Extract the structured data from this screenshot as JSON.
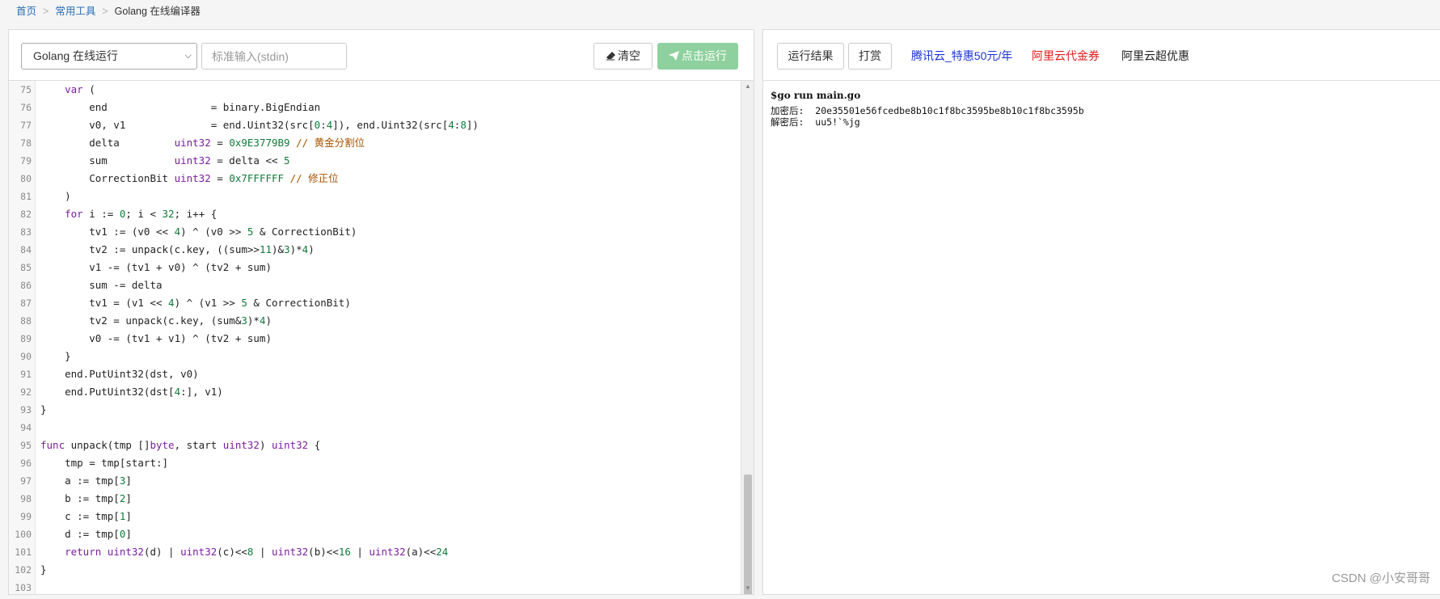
{
  "breadcrumb": {
    "items": [
      "首页",
      "常用工具"
    ],
    "separator": ">",
    "current": "Golang 在线编译器"
  },
  "toolbar": {
    "language_select": "Golang 在线运行",
    "stdin_placeholder": "标准输入(stdin)",
    "clear_label": "清空",
    "run_label": "点击运行"
  },
  "editor": {
    "lines": [
      {
        "n": "75",
        "t": [
          [
            "    "
          ],
          [
            "var",
            "kw"
          ],
          [
            " ("
          ]
        ]
      },
      {
        "n": "76",
        "t": [
          [
            "        end                 = binary.BigEndian"
          ]
        ]
      },
      {
        "n": "77",
        "t": [
          [
            "        v0, v1              = end.Uint32(src["
          ],
          [
            "0",
            "num"
          ],
          [
            ":"
          ],
          [
            "4",
            "num"
          ],
          [
            "]), end.Uint32(src["
          ],
          [
            "4",
            "num"
          ],
          [
            ":"
          ],
          [
            "8",
            "num"
          ],
          [
            "])"
          ]
        ]
      },
      {
        "n": "78",
        "t": [
          [
            "        delta         "
          ],
          [
            "uint32",
            "kw"
          ],
          [
            " = "
          ],
          [
            "0x9E3779B9",
            "num"
          ],
          [
            " "
          ],
          [
            "// 黄金分割位",
            "cm"
          ]
        ]
      },
      {
        "n": "79",
        "t": [
          [
            "        sum           "
          ],
          [
            "uint32",
            "kw"
          ],
          [
            " = delta << "
          ],
          [
            "5",
            "num"
          ]
        ]
      },
      {
        "n": "80",
        "t": [
          [
            "        CorrectionBit "
          ],
          [
            "uint32",
            "kw"
          ],
          [
            " = "
          ],
          [
            "0x7FFFFFF",
            "num"
          ],
          [
            " "
          ],
          [
            "// 修正位",
            "cm"
          ]
        ]
      },
      {
        "n": "81",
        "t": [
          [
            "    )"
          ]
        ]
      },
      {
        "n": "82",
        "t": [
          [
            "    "
          ],
          [
            "for",
            "kw"
          ],
          [
            " i := "
          ],
          [
            "0",
            "num"
          ],
          [
            "; i < "
          ],
          [
            "32",
            "num"
          ],
          [
            "; i++ {"
          ]
        ]
      },
      {
        "n": "83",
        "t": [
          [
            "        tv1 := (v0 << "
          ],
          [
            "4",
            "num"
          ],
          [
            ") ^ (v0 >> "
          ],
          [
            "5",
            "num"
          ],
          [
            " & CorrectionBit)"
          ]
        ]
      },
      {
        "n": "84",
        "t": [
          [
            "        tv2 := unpack(c.key, ((sum>>"
          ],
          [
            "11",
            "num"
          ],
          [
            ")&"
          ],
          [
            "3",
            "num"
          ],
          [
            ")*"
          ],
          [
            "4",
            "num"
          ],
          [
            ")"
          ]
        ]
      },
      {
        "n": "85",
        "t": [
          [
            "        v1 -= (tv1 + v0) ^ (tv2 + sum)"
          ]
        ]
      },
      {
        "n": "86",
        "t": [
          [
            "        sum -= delta"
          ]
        ]
      },
      {
        "n": "87",
        "t": [
          [
            "        tv1 = (v1 << "
          ],
          [
            "4",
            "num"
          ],
          [
            ") ^ (v1 >> "
          ],
          [
            "5",
            "num"
          ],
          [
            " & CorrectionBit)"
          ]
        ]
      },
      {
        "n": "88",
        "t": [
          [
            "        tv2 = unpack(c.key, (sum&"
          ],
          [
            "3",
            "num"
          ],
          [
            ")*"
          ],
          [
            "4",
            "num"
          ],
          [
            ")"
          ]
        ]
      },
      {
        "n": "89",
        "t": [
          [
            "        v0 -= (tv1 + v1) ^ (tv2 + sum)"
          ]
        ]
      },
      {
        "n": "90",
        "t": [
          [
            "    }"
          ]
        ]
      },
      {
        "n": "91",
        "t": [
          [
            "    end.PutUint32(dst, v0)"
          ]
        ]
      },
      {
        "n": "92",
        "t": [
          [
            "    end.PutUint32(dst["
          ],
          [
            "4",
            "num"
          ],
          [
            ":], v1)"
          ]
        ]
      },
      {
        "n": "93",
        "t": [
          [
            "}"
          ]
        ]
      },
      {
        "n": "94",
        "t": [
          [
            ""
          ]
        ]
      },
      {
        "n": "95",
        "t": [
          [
            "func",
            "kw"
          ],
          [
            " unpack(tmp []"
          ],
          [
            "byte",
            "kw"
          ],
          [
            ", start "
          ],
          [
            "uint32",
            "kw"
          ],
          [
            ") "
          ],
          [
            "uint32",
            "kw"
          ],
          [
            " {"
          ]
        ]
      },
      {
        "n": "96",
        "t": [
          [
            "    tmp = tmp[start:]"
          ]
        ]
      },
      {
        "n": "97",
        "t": [
          [
            "    a := tmp["
          ],
          [
            "3",
            "num"
          ],
          [
            "]"
          ]
        ]
      },
      {
        "n": "98",
        "t": [
          [
            "    b := tmp["
          ],
          [
            "2",
            "num"
          ],
          [
            "]"
          ]
        ]
      },
      {
        "n": "99",
        "t": [
          [
            "    c := tmp["
          ],
          [
            "1",
            "num"
          ],
          [
            "]"
          ]
        ]
      },
      {
        "n": "100",
        "t": [
          [
            "    d := tmp["
          ],
          [
            "0",
            "num"
          ],
          [
            "]"
          ]
        ]
      },
      {
        "n": "101",
        "t": [
          [
            "    "
          ],
          [
            "return",
            "kw"
          ],
          [
            " "
          ],
          [
            "uint32",
            "kw"
          ],
          [
            "(d) | "
          ],
          [
            "uint32",
            "kw"
          ],
          [
            "(c)<<"
          ],
          [
            "8",
            "num"
          ],
          [
            " | "
          ],
          [
            "uint32",
            "kw"
          ],
          [
            "(b)<<"
          ],
          [
            "16",
            "num"
          ],
          [
            " | "
          ],
          [
            "uint32",
            "kw"
          ],
          [
            "(a)<<"
          ],
          [
            "24",
            "num"
          ]
        ]
      },
      {
        "n": "102",
        "t": [
          [
            "}"
          ]
        ]
      },
      {
        "n": "103",
        "t": [
          [
            ""
          ]
        ]
      }
    ]
  },
  "output_toolbar": {
    "result_tab": "运行结果",
    "tip_tab": "打赏",
    "links": [
      {
        "label": "腾讯云_特惠50元/年",
        "color": "#1a33d6"
      },
      {
        "label": "阿里云代金券",
        "color": "#e01b1b"
      },
      {
        "label": "阿里云超优惠",
        "color": "#222222"
      }
    ]
  },
  "output": {
    "command": "$go run main.go",
    "encrypted_label": "加密后:",
    "encrypted_value": "20e35501e56fcedbe8b10c1f8bc3595be8b10c1f8bc3595b",
    "decrypted_label": "解密后:",
    "decrypted_value": "uu5!`%jg"
  },
  "watermark": "CSDN @小安哥哥",
  "colors": {
    "run_button": "#8fd19e",
    "link": "#2a6fb5",
    "keyword": "#7a1fa0",
    "number": "#117a3a",
    "comment": "#a55400"
  }
}
